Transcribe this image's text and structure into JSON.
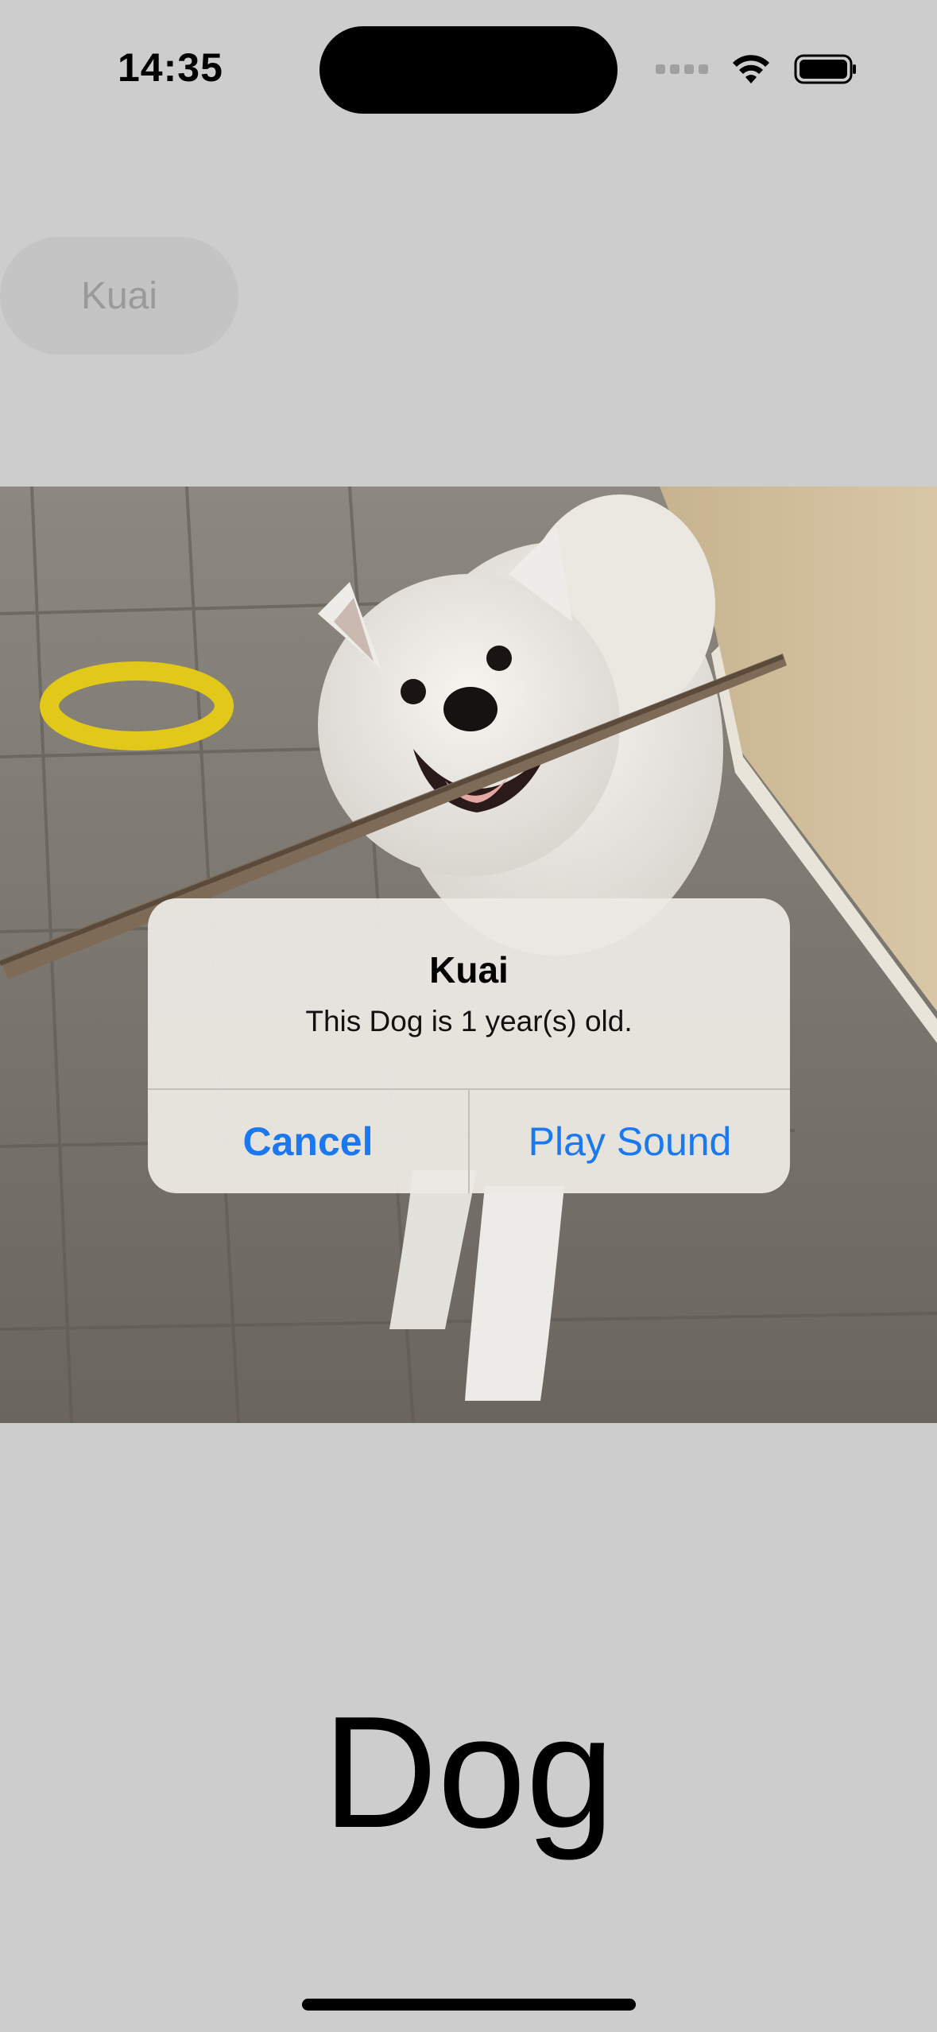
{
  "status_bar": {
    "time": "14:35"
  },
  "nav": {
    "pill_label": "Kuai"
  },
  "photo": {
    "subject": "dog-photo"
  },
  "alert": {
    "title": "Kuai",
    "message": "This Dog is 1 year(s) old.",
    "cancel_label": "Cancel",
    "play_label": "Play Sound",
    "button_color": "#1a78f0"
  },
  "main": {
    "animal_label": "Dog"
  }
}
